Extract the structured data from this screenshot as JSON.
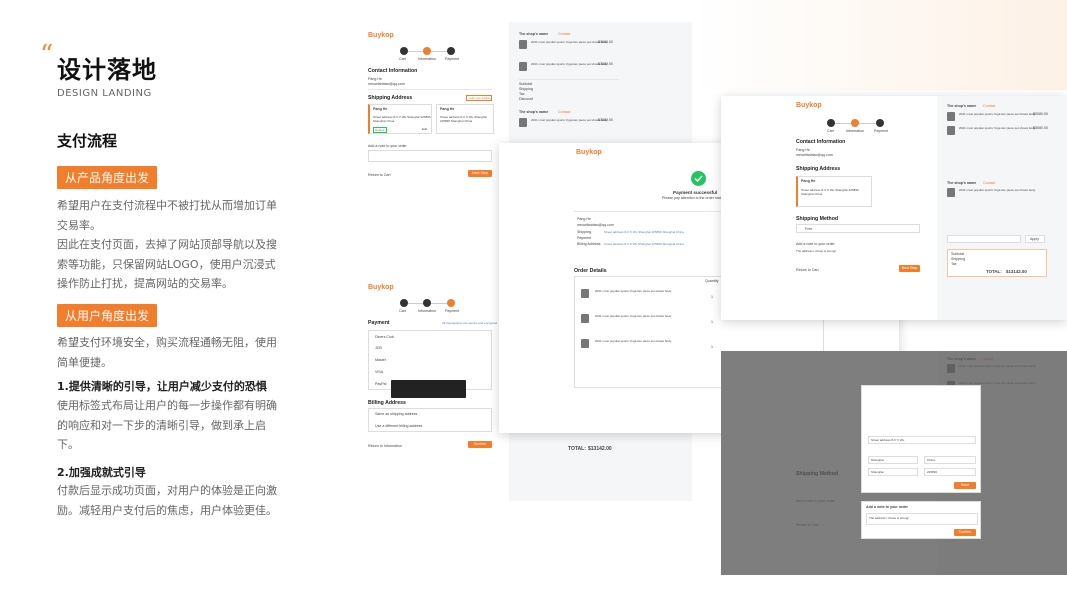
{
  "left": {
    "title": "设计落地",
    "subtitle": "DESIGN LANDING",
    "section": "支付流程",
    "tag1": "从产品角度出发",
    "para1": "希望用户在支付流程中不被打扰从而增加订单交易率。",
    "para1b": "因此在支付页面，去掉了网站顶部导航以及搜索等功能，只保留网站LOGO，使用户沉浸式操作防止打扰，提高网站的交易率。",
    "tag2": "从用户角度出发",
    "para2": "希望支付环境安全，购买流程通畅无阻，使用简单便捷。",
    "h1": "1.提供清晰的引导，让用户减少支付的恐惧",
    "para3": "使用标签式布局让用户的每一步操作都有明确的响应和对一下步的清晰引导，做到承上启下。",
    "h2": "2.加强成就式引导",
    "para4": "付款后显示成功页面，对用户的体验是正向激励。减轻用户支付后的焦虑，用户体验更佳。"
  },
  "app": {
    "logo_a": "Buy",
    "logo_b": "kop",
    "steps": [
      "Cart",
      "Information",
      "Payment"
    ],
    "contact": "Contact Information",
    "contact_name": "Pang He",
    "contact_email": "meowfanbiao@qq.com",
    "shipping": "Shipping Address",
    "add_address": "Add new address",
    "addr_name": "Pang He",
    "addr_line": "Street address 8-3 Yi Wu Shanghai 225896 Shanghai China",
    "default_tag": "Default",
    "edit": "Edit",
    "note_label": "Add a note to your order",
    "return_cart": "Return to Cart",
    "next_step": "Next Step",
    "shipping_method": "Shipping Method",
    "free": "Free",
    "shop_name": "The shop's name",
    "contact_btn": "Contact",
    "product": "2021 most popular sports Yoga two piece set shows body",
    "price": "$3080.00",
    "subtotal": "Subtotal",
    "shipping_l": "Shipping",
    "tax": "Tax",
    "discount": "Discount",
    "total_label": "TOTAL:",
    "total_value": "$13142.00",
    "payment": "Payment",
    "payment_hint": "All transactions are secure and encrypted",
    "pay_options": [
      "Diners Club",
      "JCB",
      "Master",
      "VISA",
      "PayPal"
    ],
    "billing": "Billing Address",
    "bill_same": "Same as shipping address",
    "bill_diff": "Use a different billing address",
    "return_info": "Return to Information",
    "confirm": "Confirm",
    "success_title": "Payment successful",
    "success_sub": "Please pay attention to the order status in time",
    "order_details": "Order Details",
    "quantity": "Quantity",
    "qty": "1",
    "shop_more": "Shop more",
    "apply": "Apply",
    "modal_title": "Add a note to your order",
    "modal_text": "The address I chose is wrong!",
    "save": "Save",
    "confirm_modal": "Confirm",
    "country_a": "Shanghai",
    "country_b": "China",
    "zip": "225896",
    "street": "Street address 8-3 Yi Wu"
  },
  "colors": {
    "accent": "#f27d2b",
    "logo": "#1e3a8a",
    "success": "#22c55e"
  }
}
